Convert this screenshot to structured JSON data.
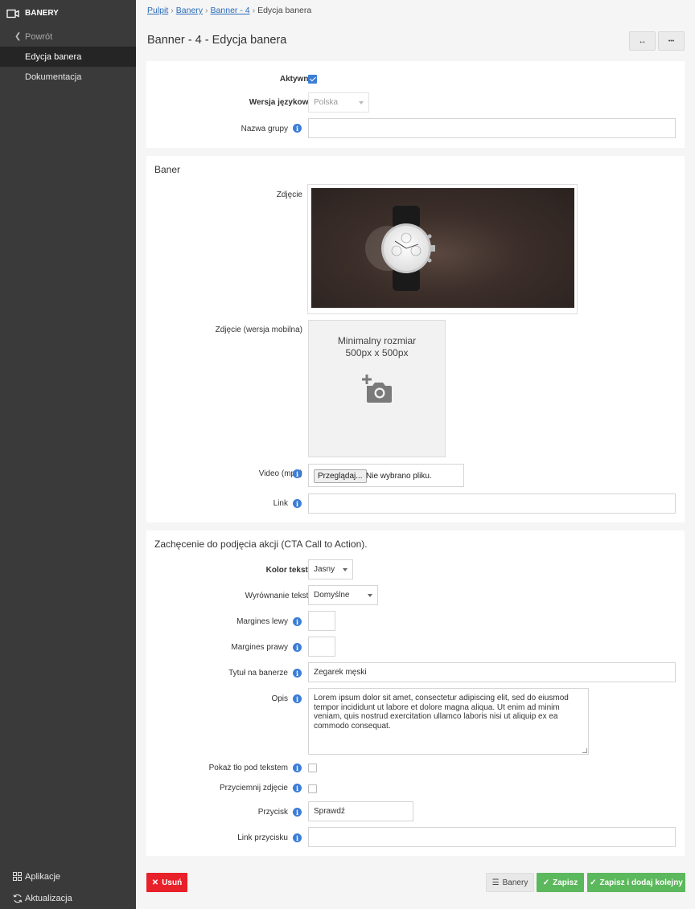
{
  "sidebar": {
    "title": "BANERY",
    "back": "Powrót",
    "items": [
      "Edycja banera",
      "Dokumentacja"
    ],
    "bottom": [
      "Aplikacje",
      "Aktualizacja"
    ]
  },
  "breadcrumb": {
    "items": [
      "Pulpit",
      "Banery",
      "Banner - 4"
    ],
    "current": "Edycja banera"
  },
  "page_title": "Banner - 4 - Edycja banera",
  "header_buttons": {
    "expand": "↔",
    "more": "•••"
  },
  "general": {
    "active_label": "Aktywny",
    "active_checked": true,
    "lang_label": "Wersja językowa",
    "lang_value": "Polska",
    "group_label": "Nazwa grupy",
    "group_value": ""
  },
  "banner": {
    "title": "Baner",
    "image_label": "Zdjęcie",
    "mobile_image_label": "Zdjęcie (wersja mobilna)",
    "mobile_min_line1": "Minimalny rozmiar",
    "mobile_min_line2": "500px x 500px",
    "video_label": "Video (mp4)",
    "browse_btn": "Przeglądaj...",
    "no_file": "Nie wybrano pliku.",
    "link_label": "Link",
    "link_value": ""
  },
  "cta": {
    "title": "Zachęcenie do podjęcia akcji (CTA Call to Action).",
    "text_color_label": "Kolor tekstu",
    "text_color_value": "Jasny",
    "align_label": "Wyrównanie tekstu",
    "align_value": "Domyślne",
    "margin_left_label": "Margines lewy",
    "margin_right_label": "Margines prawy",
    "banner_title_label": "Tytuł na banerze",
    "banner_title_value": "Zegarek męski",
    "desc_label": "Opis",
    "desc_value": "Lorem ipsum dolor sit amet, consectetur adipiscing elit, sed do eiusmod tempor incididunt ut labore et dolore magna aliqua. Ut enim ad minim veniam, quis nostrud exercitation ullamco laboris nisi ut aliquip ex ea commodo consequat.",
    "show_bg_label": "Pokaż tło pod tekstem",
    "darken_label": "Przyciemnij zdjęcie",
    "button_label": "Przycisk",
    "button_value": "Sprawdź",
    "button_link_label": "Link przycisku",
    "button_link_value": ""
  },
  "footer": {
    "delete": "Usuń",
    "list": "Banery",
    "save": "Zapisz",
    "save_add": "Zapisz i dodaj kolejny"
  },
  "colors": {
    "accent": "#3b7dd8",
    "danger": "#e8202a",
    "success": "#5cb85c",
    "sidebar": "#3a3a3a"
  }
}
